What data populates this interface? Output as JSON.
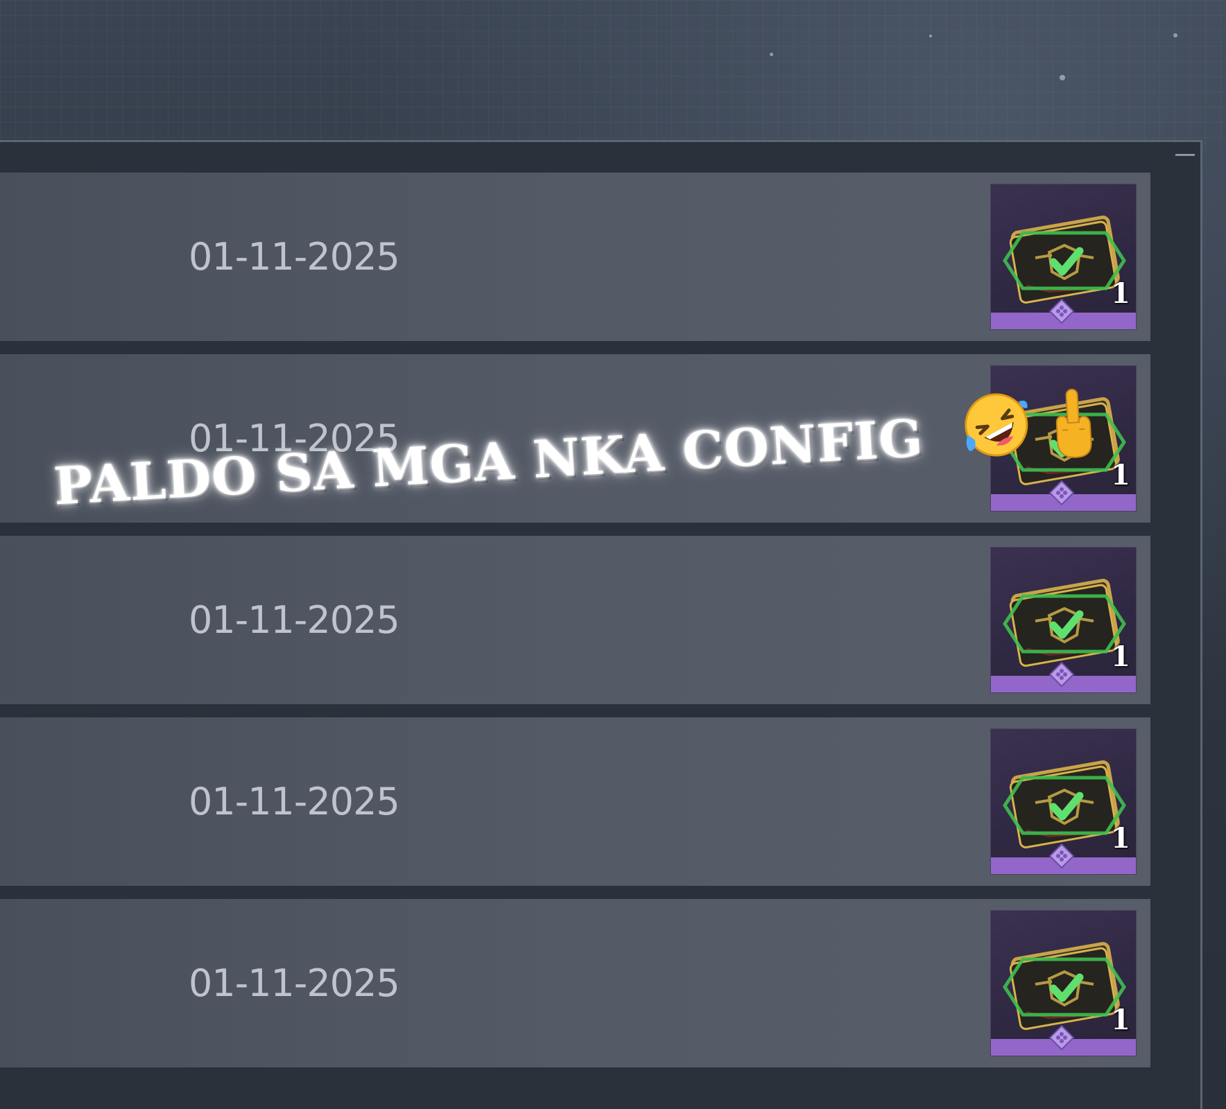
{
  "rewards_list": {
    "rows": [
      {
        "date": "01-11-2025",
        "reward": {
          "icon": "green-check-card-icon",
          "quantity": "1",
          "rarity_color": "#9267c9"
        }
      },
      {
        "date": "01-11-2025",
        "reward": {
          "icon": "green-check-card-icon",
          "quantity": "1",
          "rarity_color": "#9267c9"
        }
      },
      {
        "date": "01-11-2025",
        "reward": {
          "icon": "green-check-card-icon",
          "quantity": "1",
          "rarity_color": "#9267c9"
        }
      },
      {
        "date": "01-11-2025",
        "reward": {
          "icon": "green-check-card-icon",
          "quantity": "1",
          "rarity_color": "#9267c9"
        }
      },
      {
        "date": "01-11-2025",
        "reward": {
          "icon": "green-check-card-icon",
          "quantity": "1",
          "rarity_color": "#9267c9"
        }
      }
    ]
  },
  "overlay": {
    "caption": "PALDO SA MGA NKA CONFIG",
    "emojis": [
      "rolling-on-floor-laughing-emoji",
      "middle-finger-emoji"
    ]
  },
  "colors": {
    "row_background": "#545a66",
    "panel_background": "#2b313b",
    "date_text": "#bfc4cc",
    "rarity_purple": "#9267c9",
    "check_green": "#4fd66a",
    "card_gold": "#c9a44a"
  }
}
